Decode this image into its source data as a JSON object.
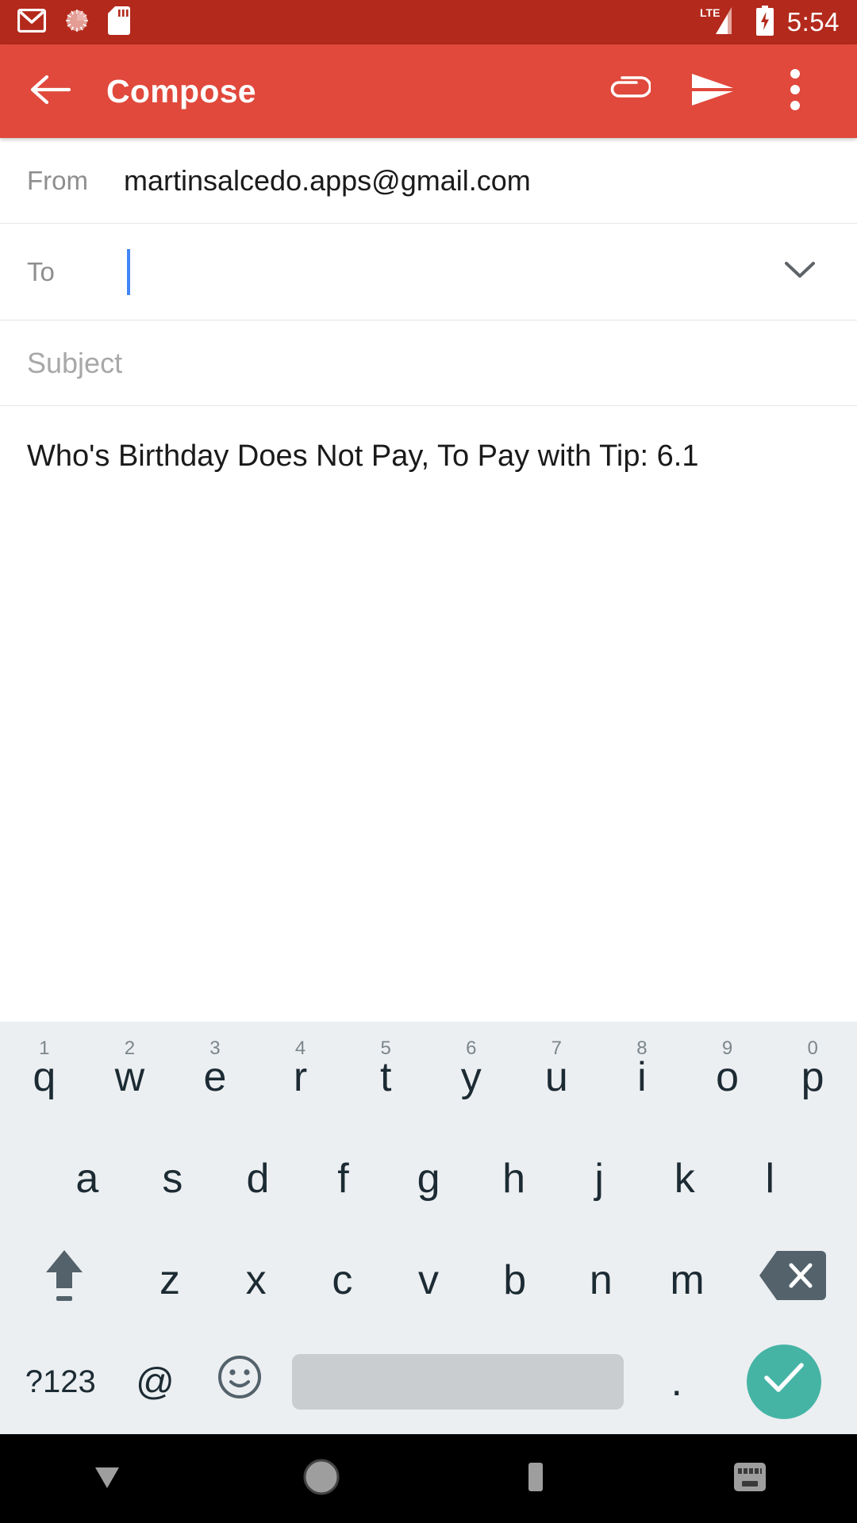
{
  "status_bar": {
    "icons": [
      "gmail-icon",
      "sync-spinner-icon",
      "sd-card-icon"
    ],
    "network_label": "LTE",
    "signal": "signal-bars-icon",
    "battery": "battery-charging-icon",
    "time": "5:54",
    "background_color": "#b3291c"
  },
  "app_bar": {
    "back_icon": "back-arrow-icon",
    "title": "Compose",
    "attach_icon": "attachment-paperclip-icon",
    "send_icon": "send-paper-plane-icon",
    "overflow_icon": "more-vertical-icon",
    "background_color": "#e0493c"
  },
  "compose": {
    "from_label": "From",
    "from_value": "martinsalcedo.apps@gmail.com",
    "to_label": "To",
    "to_value": "",
    "to_placeholder": "",
    "expand_icon": "chevron-down-icon",
    "subject_placeholder": "Subject",
    "subject_value": "",
    "body_text": "Who's Birthday Does Not Pay, To Pay with Tip: 6.1",
    "cursor_color": "#4285f4"
  },
  "keyboard": {
    "background_color": "#eceff1",
    "key_text_color": "#1c2b33",
    "enter_color": "#45b4a5",
    "spacebar_color": "#c9cdd0",
    "row1": [
      {
        "key": "q",
        "num": "1"
      },
      {
        "key": "w",
        "num": "2"
      },
      {
        "key": "e",
        "num": "3"
      },
      {
        "key": "r",
        "num": "4"
      },
      {
        "key": "t",
        "num": "5"
      },
      {
        "key": "y",
        "num": "6"
      },
      {
        "key": "u",
        "num": "7"
      },
      {
        "key": "i",
        "num": "8"
      },
      {
        "key": "o",
        "num": "9"
      },
      {
        "key": "p",
        "num": "0"
      }
    ],
    "row2": [
      "a",
      "s",
      "d",
      "f",
      "g",
      "h",
      "j",
      "k",
      "l"
    ],
    "row3_letters": [
      "z",
      "x",
      "c",
      "v",
      "b",
      "n",
      "m"
    ],
    "shift_icon": "shift-arrow-icon",
    "delete_icon": "backspace-icon",
    "symbols_label": "?123",
    "at_label": "@",
    "emoji_icon": "emoji-smiley-icon",
    "space_label": "",
    "period_label": ".",
    "enter_icon": "checkmark-icon"
  },
  "nav_bar": {
    "down_icon": "hide-keyboard-down-icon",
    "home_icon": "home-circle-icon",
    "recents_icon": "recents-square-icon",
    "keyboard_switch_icon": "keyboard-switcher-icon",
    "background_color": "#000000"
  }
}
